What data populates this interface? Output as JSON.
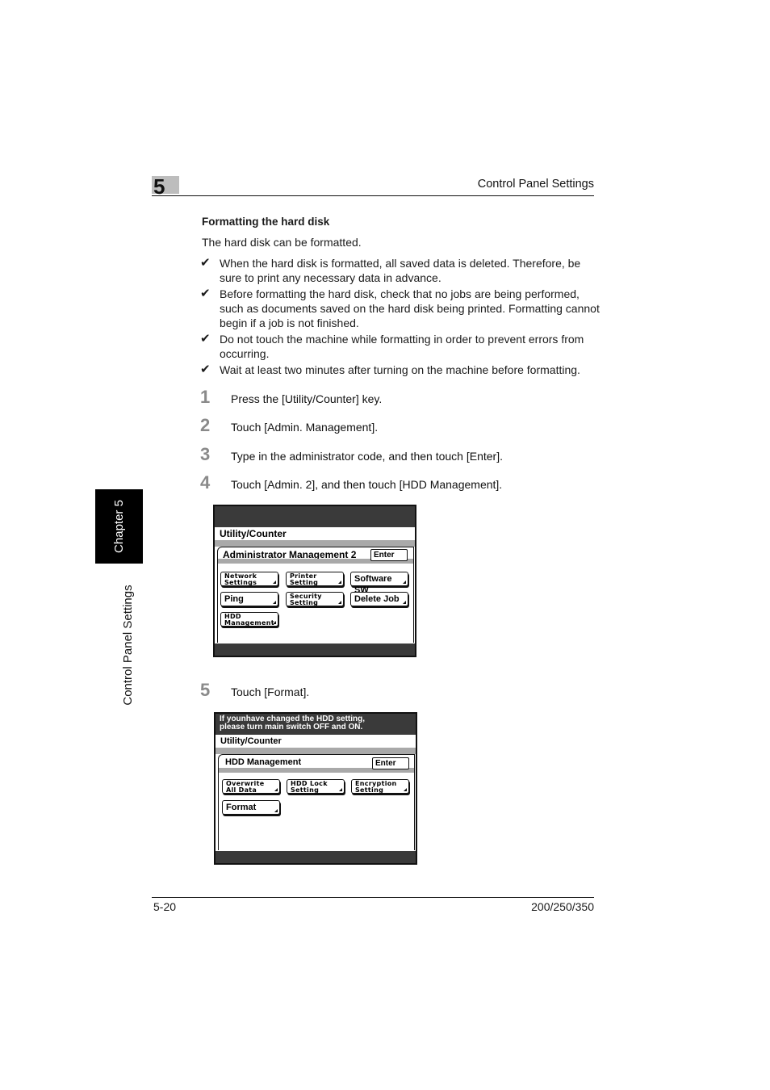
{
  "header": {
    "chapter_number": "5",
    "title": "Control Panel Settings"
  },
  "side_tab": {
    "chapter_label": "Chapter 5",
    "section_label": "Control Panel Settings"
  },
  "section": {
    "title": "Formatting the hard disk",
    "intro": "The hard disk can be formatted.",
    "check_icon": "✔",
    "notes": [
      "When the hard disk is formatted, all saved data is deleted. Therefore, be sure to print any necessary data in advance.",
      "Before formatting the hard disk, check that no jobs are being performed, such as documents saved on the hard disk being printed. Formatting cannot begin if a job is not finished.",
      "Do not touch the machine while formatting in order to prevent errors from occurring.",
      "Wait at least two minutes after turning on the machine before formatting."
    ]
  },
  "steps": [
    {
      "num": "1",
      "text": "Press the [Utility/Counter] key."
    },
    {
      "num": "2",
      "text": "Touch [Admin. Management]."
    },
    {
      "num": "3",
      "text": "Type in the administrator code, and then touch [Enter]."
    },
    {
      "num": "4",
      "text": "Touch [Admin. 2], and then touch [HDD Management]."
    },
    {
      "num": "5",
      "text": "Touch [Format]."
    }
  ],
  "screen1": {
    "message": "",
    "title": "Utility/Counter",
    "panel_title": "Administrator Management 2",
    "enter_label": "Enter",
    "buttons": [
      {
        "label": "Network\nSettings",
        "big": false
      },
      {
        "label": "Printer\nSetting",
        "big": false
      },
      {
        "label": "Software SW",
        "big": true
      },
      {
        "label": "Ping",
        "big": true
      },
      {
        "label": "Security\nSetting",
        "big": false
      },
      {
        "label": "Delete Job",
        "big": true
      },
      {
        "label": "HDD\nManagement",
        "big": false
      }
    ]
  },
  "screen2": {
    "message": "If younhave changed the HDD setting,\nplease turn main switch OFF and ON.",
    "title": "Utility/Counter",
    "panel_title": "HDD Management",
    "enter_label": "Enter",
    "buttons": [
      {
        "label": "Overwrite\nAll Data",
        "big": false
      },
      {
        "label": "HDD Lock\nSetting",
        "big": false
      },
      {
        "label": "Encryption\nSetting",
        "big": false
      },
      {
        "label": "Format",
        "big": true
      }
    ]
  },
  "footer": {
    "page_number": "5-20",
    "model": "200/250/350"
  }
}
